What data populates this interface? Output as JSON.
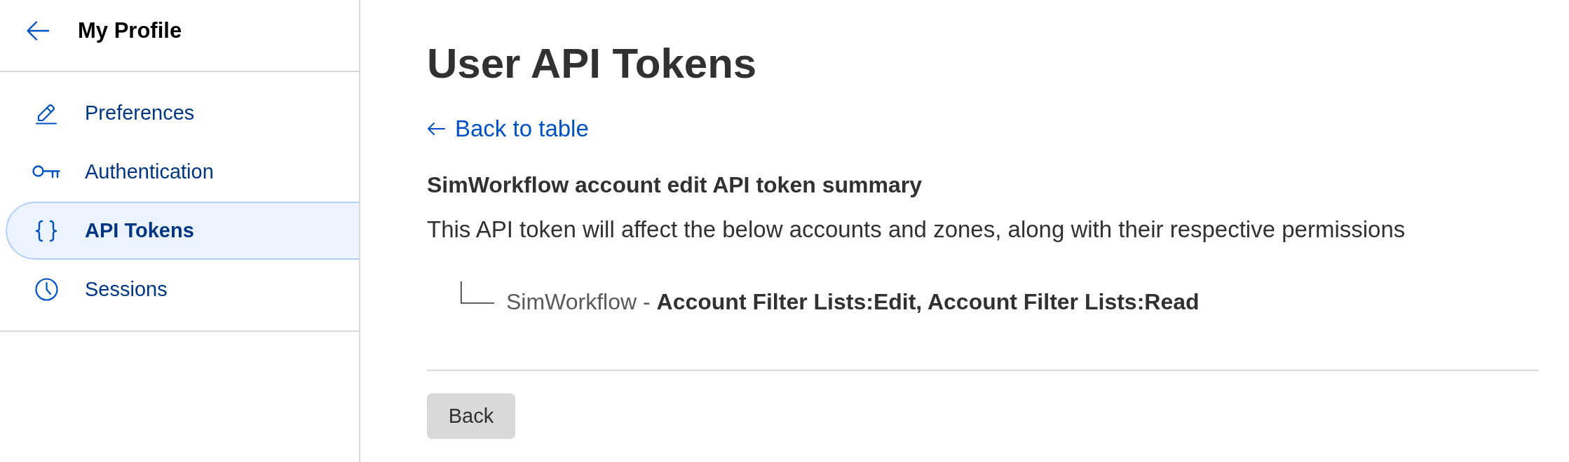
{
  "sidebar": {
    "title": "My Profile",
    "items": [
      {
        "label": "Preferences",
        "selected": false
      },
      {
        "label": "Authentication",
        "selected": false
      },
      {
        "label": "API Tokens",
        "selected": true
      },
      {
        "label": "Sessions",
        "selected": false
      }
    ]
  },
  "main": {
    "title": "User API Tokens",
    "back_link": "Back to table",
    "summary": {
      "heading": "SimWorkflow account edit API token summary",
      "description": "This API token will affect the below accounts and zones, along with their respective permissions",
      "accounts": [
        {
          "entry": "SimWorkflow - **Account Filter Lists:Edit, Account Filter Lists:Read**"
        }
      ]
    },
    "buttons": [
      {
        "label": "Back"
      }
    ]
  }
}
